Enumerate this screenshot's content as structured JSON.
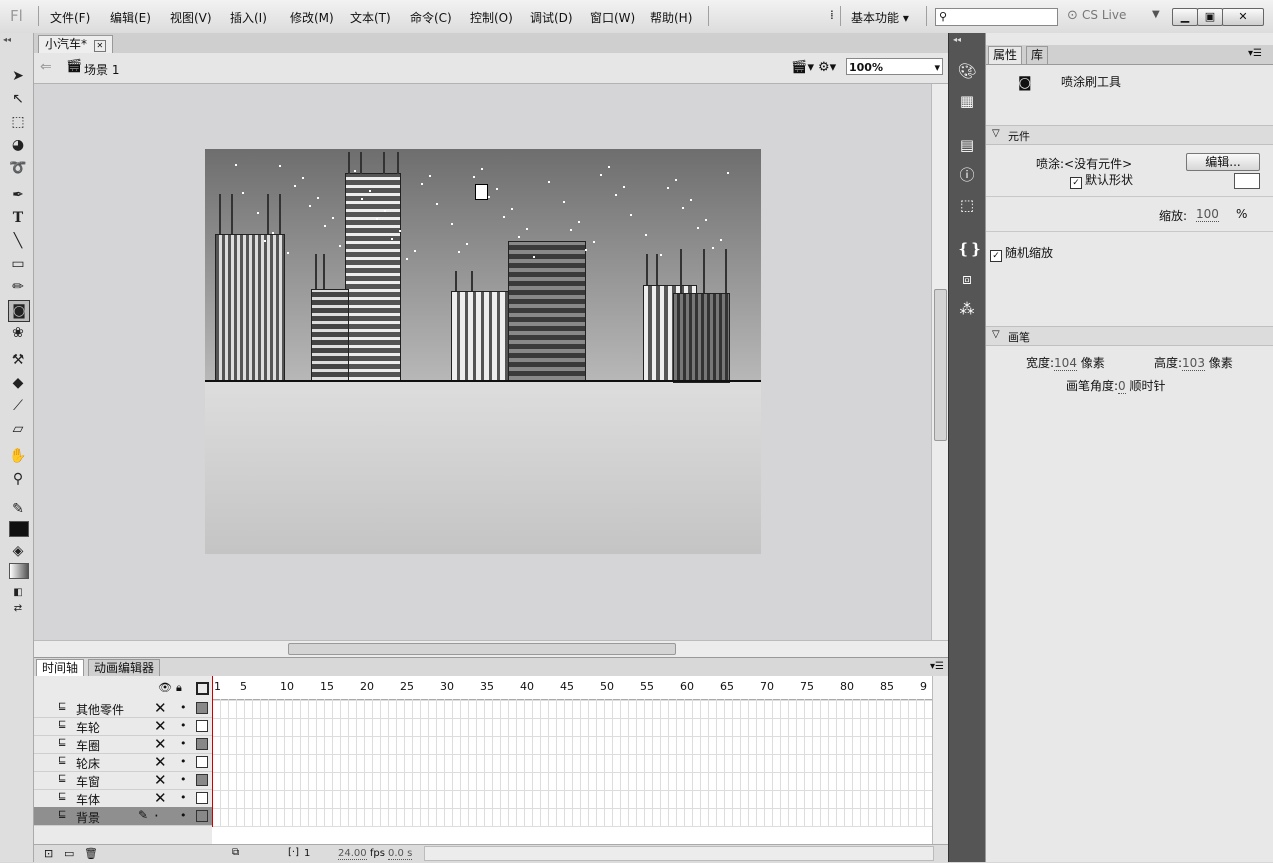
{
  "app_logo": "Fl",
  "menu": [
    "文件(F)",
    "编辑(E)",
    "视图(V)",
    "插入(I)",
    "修改(M)",
    "文本(T)",
    "命令(C)",
    "控制(O)",
    "调试(D)",
    "窗口(W)",
    "帮助(H)"
  ],
  "workspace": "基本功能",
  "cs_live": "CS Live",
  "document": {
    "tab_title": "小汽车*",
    "scene": "场景 1",
    "zoom": "100%"
  },
  "timeline": {
    "tabs": [
      "时间轴",
      "动画编辑器"
    ],
    "frame_numbers": [
      "1",
      "5",
      "10",
      "15",
      "20",
      "25",
      "30",
      "35",
      "40",
      "45",
      "50",
      "55",
      "60",
      "65",
      "70",
      "75",
      "80",
      "85",
      "9"
    ],
    "layers": [
      {
        "name": "其他零件",
        "selected": false
      },
      {
        "name": "车轮",
        "selected": false
      },
      {
        "name": "车圈",
        "selected": false
      },
      {
        "name": "轮床",
        "selected": false
      },
      {
        "name": "车窗",
        "selected": false
      },
      {
        "name": "车体",
        "selected": false
      },
      {
        "name": "背景",
        "selected": true
      }
    ],
    "status": {
      "frame": "1",
      "fps": "24.00",
      "fps_unit": "fps",
      "time": "0.0 s"
    }
  },
  "properties": {
    "tabs": [
      "属性",
      "库"
    ],
    "tool_name": "喷涂刷工具",
    "symbol_section": "元件",
    "spray_label": "喷涂:",
    "spray_value": "<没有元件>",
    "edit_button": "编辑...",
    "default_shape": "默认形状",
    "scale_label": "缩放:",
    "scale_value": "100",
    "scale_unit": "%",
    "random_scale": "随机缩放",
    "brush_section": "画笔",
    "width_label": "宽度:",
    "width_value": "104",
    "height_label": "高度:",
    "height_value": "103",
    "pixel_unit": "像素",
    "angle_label": "画笔角度:",
    "angle_value": "0",
    "angle_unit": "顺时针"
  }
}
